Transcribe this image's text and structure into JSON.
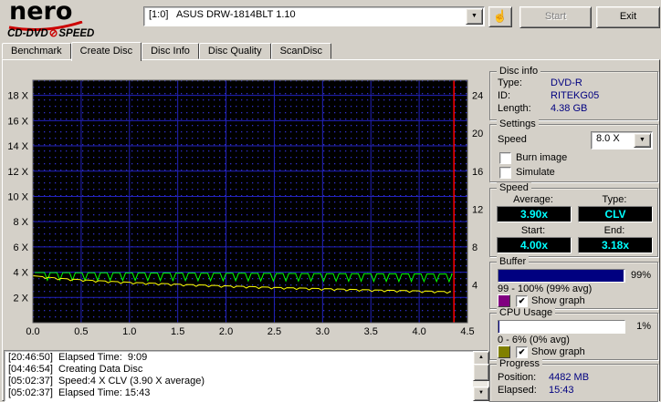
{
  "header": {
    "brand": "nero",
    "subtitle_left": "CD-DVD",
    "subtitle_right": "SPEED",
    "drive_select_value": "[1:0]   ASUS DRW-1814BLT 1.10",
    "start_label": "Start",
    "exit_label": "Exit"
  },
  "icons": {
    "dropdown_arrow_glyph": "▼",
    "arrow_up_glyph": "▲",
    "arrow_down_glyph": "▼",
    "hand_glyph": "☝",
    "slashed_disc_glyph": "⊘"
  },
  "tabs": [
    {
      "label": "Benchmark"
    },
    {
      "label": "Create Disc"
    },
    {
      "label": "Disc Info"
    },
    {
      "label": "Disc Quality"
    },
    {
      "label": "ScanDisc"
    }
  ],
  "chart_data": {
    "type": "line",
    "bg": "#000000",
    "grid_color": "#2222bb",
    "dot_color": "#3030c8",
    "x_ticks": [
      "0.0",
      "0.5",
      "1.0",
      "1.5",
      "2.0",
      "2.5",
      "3.0",
      "3.5",
      "4.0",
      "4.5"
    ],
    "x_range": [
      0,
      4.5
    ],
    "left_axis": {
      "range": [
        0,
        19.2
      ],
      "ticks": [
        18,
        16,
        14,
        12,
        10,
        8,
        6,
        4,
        2
      ],
      "labels": [
        "18 X",
        "16 X",
        "14 X",
        "12 X",
        "10 X",
        "8 X",
        "6 X",
        "4 X",
        "2 X"
      ]
    },
    "right_axis": {
      "range": [
        0,
        25.6
      ],
      "ticks": [
        24,
        20,
        16,
        12,
        8,
        4
      ],
      "labels": [
        "24",
        "20",
        "16",
        "12",
        "8",
        "4"
      ]
    },
    "end_marker": {
      "x": 4.36,
      "color": "#ff0000"
    },
    "series": [
      {
        "name": "write-speed",
        "color": "#00ff00",
        "x_start": 0.02,
        "x_end": 4.33,
        "base_start": 3.97,
        "base_end": 3.85,
        "dip_depth": 0.6,
        "dip_period": 0.13
      },
      {
        "name": "spindle-speed",
        "color": "#ffff00",
        "x_start": 0,
        "x_end": 4.33,
        "baseline_points": [
          [
            0,
            3.72
          ],
          [
            0.3,
            3.5
          ],
          [
            0.6,
            3.36
          ],
          [
            1,
            3.2
          ],
          [
            1.5,
            3.05
          ],
          [
            2,
            2.92
          ],
          [
            2.5,
            2.8
          ],
          [
            3,
            2.7
          ],
          [
            3.5,
            2.6
          ],
          [
            4,
            2.52
          ],
          [
            4.33,
            2.46
          ]
        ],
        "dip_depth": 0.13,
        "dip_period": 0.13
      }
    ]
  },
  "disc_info": {
    "title": "Disc info",
    "type_label": "Type:",
    "type": "DVD-R",
    "id_label": "ID:",
    "id": "RITEKG05",
    "length_label": "Length:",
    "length": "4.38 GB"
  },
  "settings": {
    "title": "Settings",
    "speed_label": "Speed",
    "speed_value": "8.0 X",
    "burn_image_label": "Burn image",
    "burn_image_check": "",
    "simulate_label": "Simulate",
    "simulate_check": ""
  },
  "speed": {
    "title": "Speed",
    "average_label": "Average:",
    "average_value": "3.90x",
    "type_label": "Type:",
    "type_value": "CLV",
    "start_label": "Start:",
    "start_value": "4.00x",
    "end_label": "End:",
    "end_value": "3.18x"
  },
  "buffer": {
    "title": "Buffer",
    "percent": 99,
    "percent_label": "99%",
    "fill_color": "#000080",
    "range_text": "99 - 100% (99% avg)",
    "swatch_color": "#800080",
    "check_glyph": "✔",
    "show_graph_label": "Show graph"
  },
  "cpu": {
    "title": "CPU Usage",
    "percent": 1,
    "percent_label": "1%",
    "fill_color": "#000080",
    "range_text": "0 - 6% (0% avg)",
    "swatch_color": "#808000",
    "check_glyph": "✔",
    "show_graph_label": "Show graph"
  },
  "progress": {
    "title": "Progress",
    "position_label": "Position:",
    "position_value": "4482 MB",
    "elapsed_label": "Elapsed:",
    "elapsed_value": "15:43"
  },
  "log": {
    "lines": [
      "[20:46:50]  Elapsed Time:  9:09",
      "[04:46:54]  Creating Data Disc",
      "[05:02:37]  Speed:4 X CLV (3.90 X average)",
      "[05:02:37]  Elapsed Time: 15:43"
    ]
  }
}
